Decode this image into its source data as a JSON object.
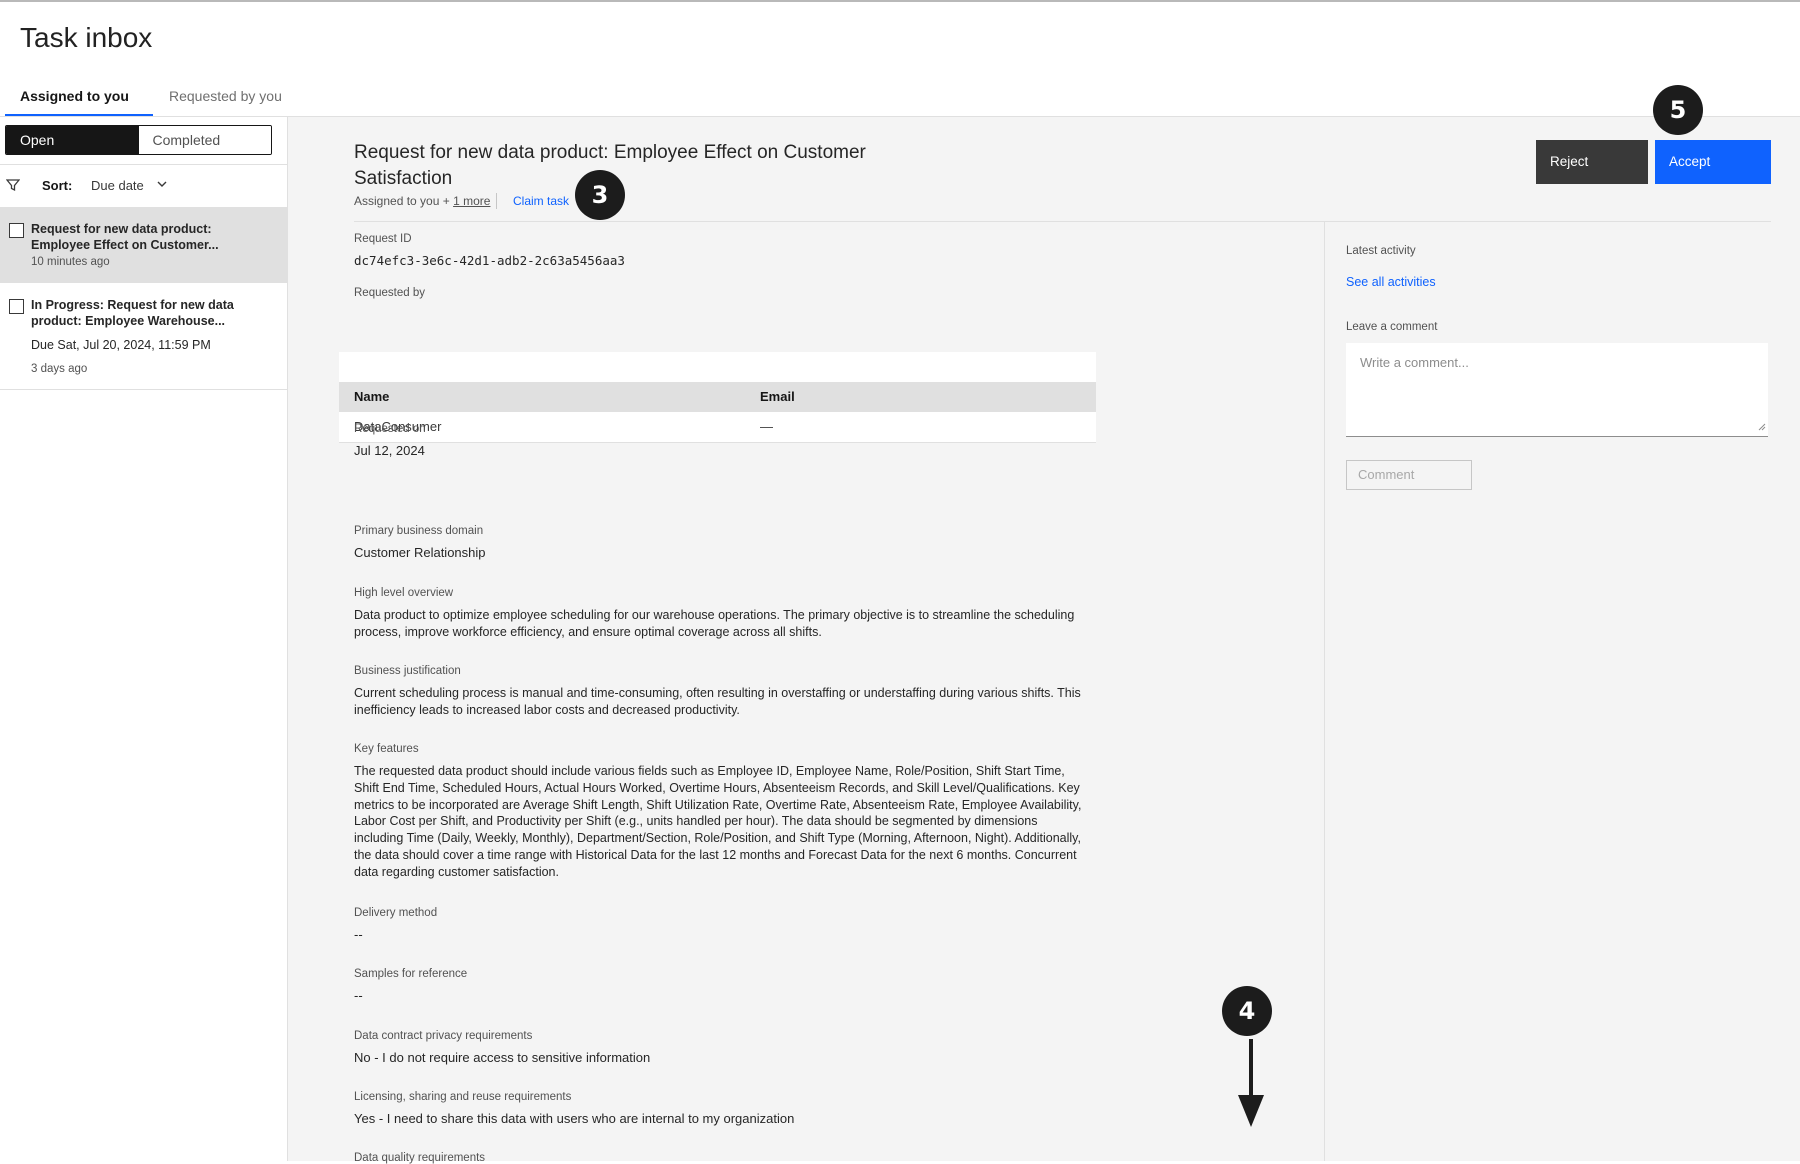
{
  "page": {
    "title": "Task inbox"
  },
  "tabs": [
    {
      "label": "Assigned to you",
      "active": true
    },
    {
      "label": "Requested by you",
      "active": false
    }
  ],
  "filter": {
    "open": "Open",
    "completed": "Completed",
    "selected": "Open"
  },
  "sort": {
    "label": "Sort:",
    "value": "Due date"
  },
  "tasks": [
    {
      "title": "Request for new data product: Employee Effect on Customer...",
      "due": "",
      "time": "10 minutes ago",
      "selected": true
    },
    {
      "title": "In Progress: Request for new data product: Employee Warehouse...",
      "due": "Due Sat, Jul 20, 2024, 11:59 PM",
      "time": "3 days ago",
      "selected": false
    }
  ],
  "detail": {
    "title": "Request for new data product: Employee Effect on Customer Satisfaction",
    "assigned_prefix": "Assigned to you + ",
    "assigned_more": "1 more",
    "claim_label": "Claim task",
    "reject_label": "Reject",
    "accept_label": "Accept",
    "fields": {
      "request_id": {
        "label": "Request ID",
        "value": "dc74efc3-3e6c-42d1-adb2-2c63a5456aa3"
      },
      "requested_by": {
        "label": "Requested by",
        "columns": [
          "Name",
          "Email"
        ],
        "rows": [
          [
            "DataConsumer",
            "—"
          ]
        ]
      },
      "requested_on": {
        "label": "Requested on",
        "value": "Jul 12, 2024"
      },
      "domain": {
        "label": "Primary business domain",
        "value": "Customer Relationship"
      },
      "overview": {
        "label": "High level overview",
        "value": "Data product to optimize employee scheduling for our warehouse operations. The primary objective is to streamline the scheduling process, improve workforce efficiency, and ensure optimal coverage across all shifts."
      },
      "justification": {
        "label": "Business justification",
        "value": "Current scheduling process is manual and time-consuming, often resulting in overstaffing or understaffing during various shifts. This inefficiency leads to increased labor costs and decreased productivity."
      },
      "key_features": {
        "label": "Key features",
        "value": "The requested data product should include various fields such as Employee ID, Employee Name, Role/Position, Shift Start Time, Shift End Time, Scheduled Hours, Actual Hours Worked, Overtime Hours, Absenteeism Records, and Skill Level/Qualifications. Key metrics to be incorporated are Average Shift Length, Shift Utilization Rate, Overtime Rate, Absenteeism Rate, Employee Availability, Labor Cost per Shift, and Productivity per Shift (e.g., units handled per hour). The data should be segmented by dimensions including Time (Daily, Weekly, Monthly), Department/Section, Role/Position, and Shift Type (Morning, Afternoon, Night). Additionally, the data should cover a time range with Historical Data for the last 12 months and Forecast Data for the next 6 months. Concurrent data regarding customer satisfaction."
      },
      "delivery": {
        "label": "Delivery method",
        "value": "--"
      },
      "samples": {
        "label": "Samples for reference",
        "value": "--"
      },
      "privacy": {
        "label": "Data contract privacy requirements",
        "value": "No - I do not require access to sensitive information"
      },
      "licensing": {
        "label": "Licensing, sharing and reuse requirements",
        "value": "Yes - I need to share this data with users who are internal to my organization"
      },
      "quality": {
        "label": "Data quality requirements"
      }
    }
  },
  "activity": {
    "latest_label": "Latest activity",
    "see_all": "See all activities",
    "comment_label": "Leave a comment",
    "comment_placeholder": "Write a comment...",
    "comment_button": "Comment"
  },
  "annotations": {
    "step3": "3",
    "step4": "4",
    "step5": "5"
  },
  "colors": {
    "accent": "#0f62fe",
    "dark": "#161616",
    "reject": "#393939",
    "panel": "#f4f4f4"
  },
  "icons": [
    "filter-icon",
    "chevron-down-icon",
    "checkbox-icon",
    "resize-handle-icon",
    "arrow-down-icon"
  ]
}
